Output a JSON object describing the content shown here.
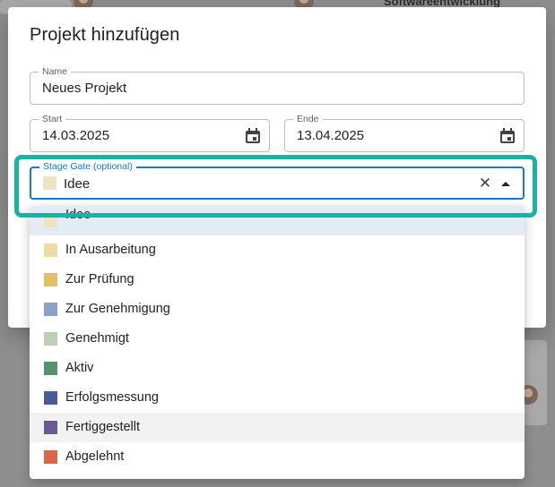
{
  "background": {
    "card_text": "Softwareentwicklung"
  },
  "dialog": {
    "title": "Projekt hinzufügen",
    "name": {
      "label": "Name",
      "value": "Neues Projekt"
    },
    "start": {
      "label": "Start",
      "value": "14.03.2025"
    },
    "end": {
      "label": "Ende",
      "value": "13.04.2025"
    },
    "stage_gate": {
      "label": "Stage Gate (optional)",
      "value": "Idee",
      "color": "#efe3c2"
    }
  },
  "dropdown": {
    "options": [
      {
        "label": "Idee",
        "color": "#efe3c2"
      },
      {
        "label": "In Ausarbeitung",
        "color": "#eedba5"
      },
      {
        "label": "Zur Prüfung",
        "color": "#e0c163"
      },
      {
        "label": "Zur Genehmigung",
        "color": "#8aa2c8"
      },
      {
        "label": "Genehmigt",
        "color": "#bcd0b3"
      },
      {
        "label": "Aktiv",
        "color": "#5a8f6d"
      },
      {
        "label": "Erfolgsmessung",
        "color": "#475c96"
      },
      {
        "label": "Fertiggestellt",
        "color": "#6c5797"
      },
      {
        "label": "Abgelehnt",
        "color": "#d9674c"
      }
    ]
  },
  "colors": {
    "accent": "#1976d2",
    "highlight": "#17b4a6"
  },
  "icons": {
    "date_picker": "calendar-icon",
    "clear": "close-icon",
    "dropdown": "arrow-up-icon"
  }
}
